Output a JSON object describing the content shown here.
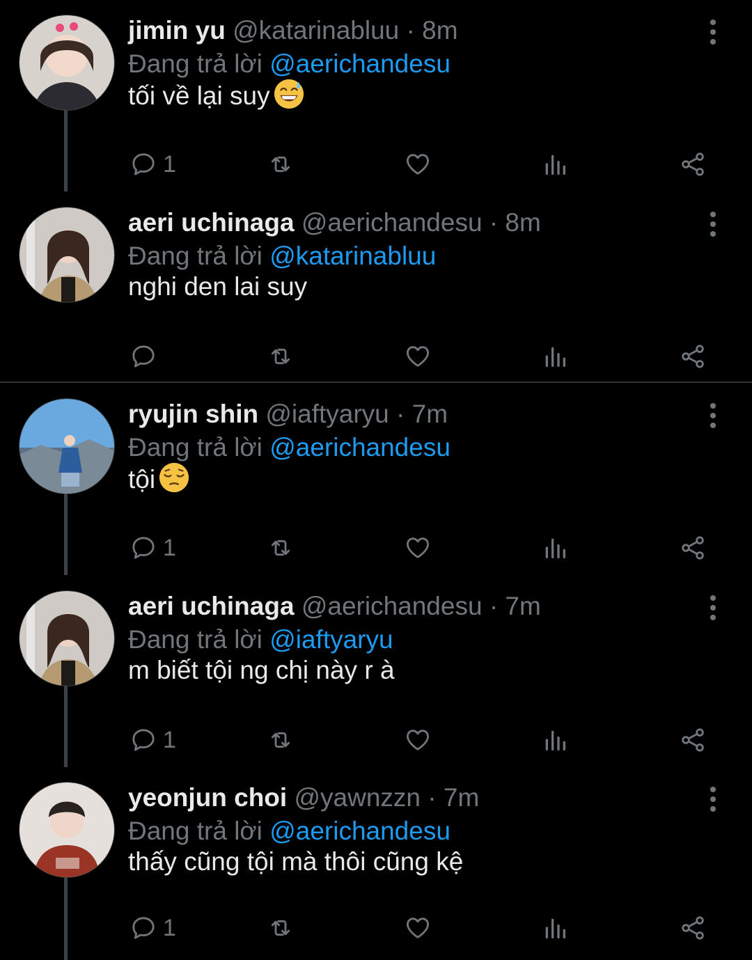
{
  "reply_prefix": "Đang trả lời",
  "tweets": [
    {
      "name": "jimin yu",
      "handle": "@katarinabluu",
      "time": "· 8m",
      "replying_to": "@aerichandesu",
      "text": "tối về lại suy",
      "emoji": "sweat-smile",
      "reply_count": "1"
    },
    {
      "name": "aeri uchinaga",
      "handle": "@aerichandesu",
      "time": "· 8m",
      "replying_to": "@katarinabluu",
      "text": "nghi den lai suy",
      "emoji": "",
      "reply_count": ""
    },
    {
      "name": "ryujin shin",
      "handle": "@iaftyaryu",
      "time": "· 7m",
      "replying_to": "@aerichandesu",
      "text": "tội",
      "emoji": "pensive",
      "reply_count": "1"
    },
    {
      "name": "aeri uchinaga",
      "handle": "@aerichandesu",
      "time": "· 7m",
      "replying_to": "@iaftyaryu",
      "text": "m biết tội ng chị này r à",
      "emoji": "",
      "reply_count": "1"
    },
    {
      "name": "yeonjun choi",
      "handle": "@yawnzzn",
      "time": "· 7m",
      "replying_to": "@aerichandesu",
      "text": "thấy cũng tội mà thôi cũng kệ",
      "emoji": "",
      "reply_count": "1"
    }
  ],
  "colors": {
    "background": "#000000",
    "text": "#e7e9ea",
    "muted": "#71767b",
    "mention": "#1d9bf0",
    "thread_line": "#3d4248"
  },
  "icons": [
    "reply-icon",
    "retweet-icon",
    "like-icon",
    "views-icon",
    "share-icon",
    "more-icon"
  ]
}
